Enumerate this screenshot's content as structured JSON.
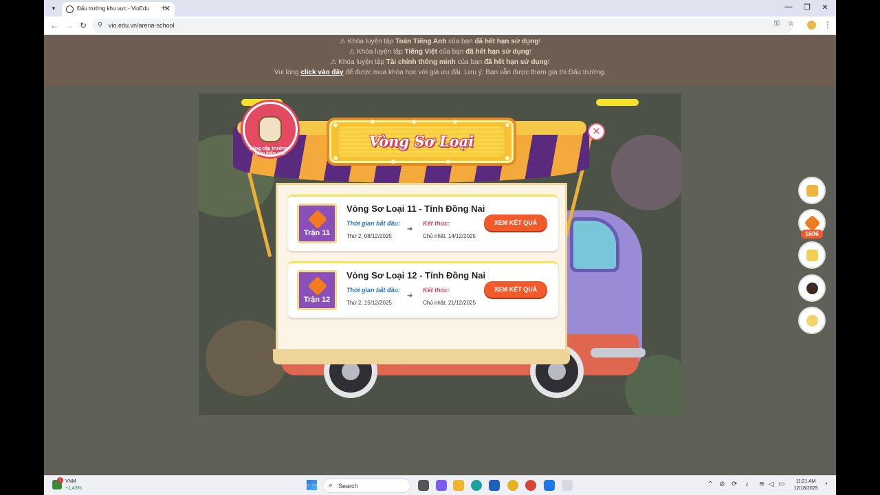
{
  "browser": {
    "tab_title": "Đấu trường khu vực - VioEdu",
    "url": "vio.edu.vn/arena-school",
    "new_tab": "+",
    "tab_close": "✕",
    "minimize": "—",
    "maximize": "❐",
    "close": "✕"
  },
  "notice": {
    "warn": "⚠",
    "line1_pre": "Khóa luyện tập",
    "line1_course": "Toán Tiếng Anh",
    "line1_mid": "của bạn",
    "line1_status": "đã hết hạn sử dụng",
    "line2_pre": "Khóa luyện tập",
    "line2_course": "Tiếng Việt",
    "line2_mid": "của bạn",
    "line2_status": "đã hết hạn sử dụng",
    "line3_pre": "Khóa luyện tập",
    "line3_course": "Tài chính thông minh",
    "line3_mid": "của bạn",
    "line3_status": "đã hết hạn sử dụng",
    "excl": "!",
    "line4_pre": "Vui lòng",
    "line4_link": "click vào đây",
    "line4_post": "để được mua khóa học với giá ưu đãi. Lưu ý: Bạn vẫn được tham gia thi Đấu trường."
  },
  "modal": {
    "title": "Vòng Sơ Loại",
    "badge_text": "vòng cấp trường · điều kiện vào",
    "close_symbol": "✕",
    "rounds": [
      {
        "icon_label": "Trận 11",
        "title": "Vòng Sơ Loại 11 - Tỉnh Đồng Nai",
        "start_label": "Thời gian bắt đầu:",
        "start_date": "Thứ 2, 08/12/2025",
        "end_label": "Kết thúc:",
        "end_date": "Chủ nhật, 14/12/2025",
        "button": "XEM KẾT QUẢ"
      },
      {
        "icon_label": "Trận 12",
        "title": "Vòng Sơ Loại 12 - Tỉnh Đồng Nai",
        "start_label": "Thời gian bắt đầu:",
        "start_date": "Thứ 2, 15/12/2025",
        "end_label": "Kết thúc:",
        "end_date": "Chủ nhật, 21/12/2025",
        "button": "XEM KẾT QUẢ"
      }
    ]
  },
  "side": {
    "gem_count": "1606"
  },
  "taskbar": {
    "widget_badge": "1",
    "widget_name": "VNM",
    "widget_value": "+1,43%",
    "search_placeholder": "Search",
    "time": "11:21 AM",
    "date": "12/18/2025"
  },
  "colors": {
    "accent_button": "#f25a2c",
    "start_label": "#2074c6",
    "end_label": "#d8465e",
    "card_icon": "#8a4fb8"
  }
}
